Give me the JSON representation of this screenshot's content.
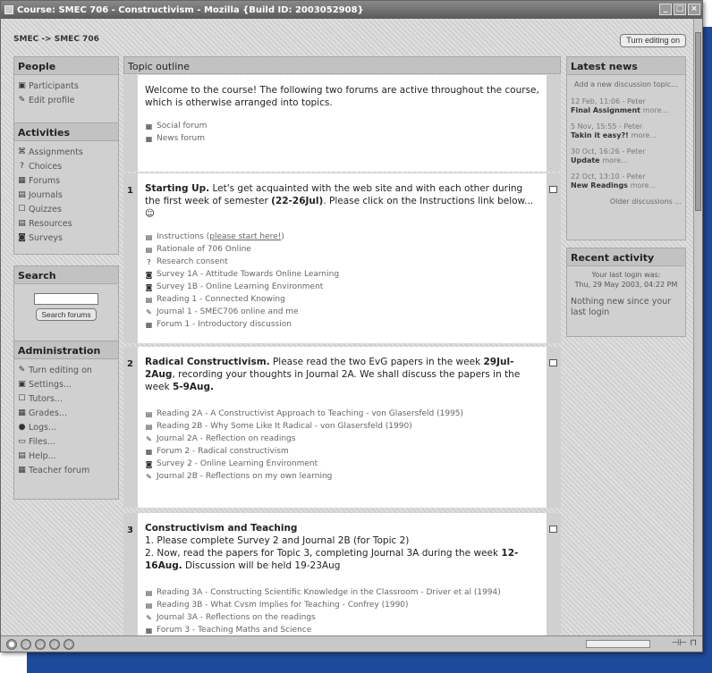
{
  "window": {
    "title": "Course: SMEC 706 - Constructivism - Mozilla {Build ID: 2003052908}"
  },
  "nav": {
    "breadcrumb": "SMEC -> SMEC 706",
    "edit_button": "Turn editing on"
  },
  "people": {
    "title": "People",
    "items": [
      {
        "label": "Participants",
        "icon": "participants-icon"
      },
      {
        "label": "Edit profile",
        "icon": "edit-profile-icon"
      }
    ]
  },
  "activities": {
    "title": "Activities",
    "items": [
      {
        "label": "Assignments",
        "icon": "assignments-icon"
      },
      {
        "label": "Choices",
        "icon": "choices-icon"
      },
      {
        "label": "Forums",
        "icon": "forums-icon"
      },
      {
        "label": "Journals",
        "icon": "journals-icon"
      },
      {
        "label": "Quizzes",
        "icon": "quizzes-icon"
      },
      {
        "label": "Resources",
        "icon": "resources-icon"
      },
      {
        "label": "Surveys",
        "icon": "surveys-icon"
      }
    ]
  },
  "search": {
    "title": "Search",
    "button": "Search forums",
    "value": ""
  },
  "administration": {
    "title": "Administration",
    "items": [
      {
        "label": "Turn editing on",
        "icon": "edit-icon"
      },
      {
        "label": "Settings...",
        "icon": "settings-icon"
      },
      {
        "label": "Tutors...",
        "icon": "tutors-icon"
      },
      {
        "label": "Grades...",
        "icon": "grades-icon"
      },
      {
        "label": "Logs...",
        "icon": "logs-icon"
      },
      {
        "label": "Files...",
        "icon": "files-icon"
      },
      {
        "label": "Help...",
        "icon": "help-icon"
      },
      {
        "label": "Teacher forum",
        "icon": "teacher-forum-icon"
      }
    ]
  },
  "topics": {
    "header": "Topic outline",
    "intro": {
      "summary": "Welcome to the course! The following two forums are active throughout the course, which is otherwise arranged into topics.",
      "resources": [
        "Social forum",
        "News forum"
      ]
    },
    "t1": {
      "num": "1",
      "title": "Starting Up.",
      "text_a": " Let's get acquainted with the web site and with each other during the first week of semester ",
      "bold": "(22-26Jul)",
      "text_b": ". Please click on the Instructions link below...",
      "instructions_label": "Instructions (",
      "instructions_link": "please start here!",
      "instructions_end": ")",
      "resources": [
        "Rationale of 706 Online",
        "Research consent",
        "Survey 1A - Attitude Towards Online Learning",
        "Survey 1B - Online Learning Environment",
        "Reading 1 - Connected Knowing",
        "Journal 1 - SMEC706 online and me",
        "Forum 1 - Introductory discussion"
      ]
    },
    "t2": {
      "num": "2",
      "title": "Radical Constructivism.",
      "text_a": " Please read the two EvG papers in the week ",
      "bold_a": "29Jul-2Aug",
      "text_b": ", recording your thoughts in Journal 2A. We shall discuss the papers in the week ",
      "bold_b": "5-9Aug.",
      "resources": [
        "Reading 2A - A Constructivist Approach to Teaching - von Glasersfeld (1995)",
        "Reading 2B - Why Some Like It Radical - von Glasersfeld (1990)",
        "Journal 2A - Reflection on readings",
        "Forum 2 - Radical constructivism",
        "Survey 2 - Online Learning Environment",
        "Journal 2B - Reflections on my own learning"
      ]
    },
    "t3": {
      "num": "3",
      "title": "Constructivism and Teaching",
      "line1": "1. Please complete Survey 2 and Journal 2B (for Topic 2)",
      "line2": "2. Now, read the papers for Topic 3, completing Journal 3A during the week ",
      "bold": "12-16Aug.",
      "line2_end": " Discussion will be held 19-23Aug",
      "resources": [
        "Reading 3A - Constructing Scientific Knowledge in the Classroom - Driver et al (1994)",
        "Reading 3B - What Cvsm Implies for Teaching - Confrey (1990)",
        "Journal 3A - Reflections on the readings",
        "Forum 3 - Teaching Maths and Science"
      ]
    }
  },
  "news": {
    "title": "Latest news",
    "add": "Add a new discussion topic...",
    "items": [
      {
        "date": "12 Feb, 11:06 - Peter",
        "title": "Final Assignment",
        "more": "more..."
      },
      {
        "date": "5 Nov, 15:55 - Peter",
        "title": "Takin it easy?!",
        "more": "more..."
      },
      {
        "date": "30 Oct, 16:26 - Peter",
        "title": "Update",
        "more": "more..."
      },
      {
        "date": "22 Oct, 13:10 - Peter",
        "title": "New Readings",
        "more": "more..."
      }
    ],
    "older": "Older discussions ..."
  },
  "recent": {
    "title": "Recent activity",
    "login_label": "Your last login was:",
    "login_date": "Thu, 29 May 2003, 04:22 PM",
    "nothing": "Nothing new since your last login"
  }
}
